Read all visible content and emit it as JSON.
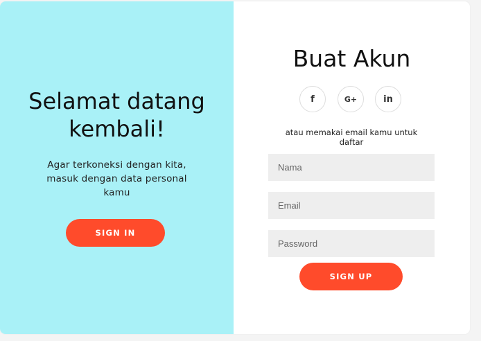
{
  "overlay": {
    "title": "Selamat datang kembali!",
    "message": "Agar terkoneksi dengan kita, masuk dengan data personal kamu",
    "signin_label": "SIGN IN"
  },
  "form": {
    "title": "Buat Akun",
    "social": [
      {
        "icon": "facebook-icon",
        "glyph": "f"
      },
      {
        "icon": "google-plus-icon",
        "glyph": "G+"
      },
      {
        "icon": "linkedin-icon",
        "glyph": "in"
      }
    ],
    "subtitle": "atau memakai email kamu untuk daftar",
    "fields": {
      "name_placeholder": "Nama",
      "email_placeholder": "Email",
      "password_placeholder": "Password"
    },
    "signup_label": "SIGN UP"
  },
  "colors": {
    "accent": "#ff4b2b",
    "overlay_bg": "#a9f1f7",
    "field_bg": "#eeeeee"
  }
}
